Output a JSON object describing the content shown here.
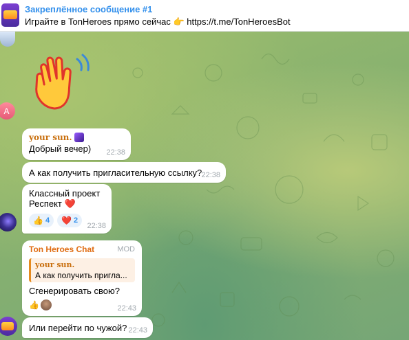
{
  "pinned": {
    "title": "Закреплённое сообщение #1",
    "text": "Играйте в TonHeroes прямо сейчас 👉 https://t.me/TonHeroesBot"
  },
  "avatars": {
    "a_letter": "A"
  },
  "messages": [
    {
      "sender": "your sun.",
      "text": "Добрый вечер)",
      "time": "22:38"
    },
    {
      "text": "А как получить пригласительную ссылку?",
      "time": "22:38"
    },
    {
      "line1": "Классный проект",
      "line2": "Респект ❤️",
      "time": "22:38",
      "reactions": [
        {
          "emoji": "👍",
          "count": "4"
        },
        {
          "emoji": "❤️",
          "count": "2"
        }
      ]
    },
    {
      "chat_name": "Ton Heroes Chat",
      "badge": "MOD",
      "reply_sender": "your sun.",
      "reply_text": "А как получить пригла...",
      "text": "Сгенерировать свою?",
      "reaction_emoji": "👍",
      "time": "22:43"
    },
    {
      "text": "Или перейти по чужой?",
      "time": "22:43"
    }
  ],
  "colors": {
    "link": "#3390ec",
    "sender_orange": "#c86e0c",
    "chat_name": "#e06c12",
    "time": "#a1a8ae"
  }
}
